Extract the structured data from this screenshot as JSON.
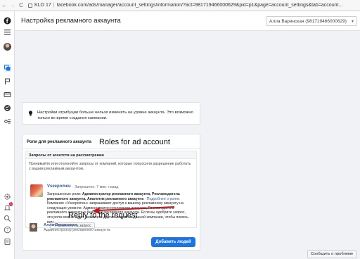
{
  "browser": {
    "back": "←",
    "forward": "→",
    "reload": "C",
    "tab_label": "KLO 17",
    "separator": "|",
    "url": "facebook.com/ads/manager/account_settings/information/?act=981719466000629&pid=p1&page=account_settings&tab=account..."
  },
  "header": {
    "title": "Настройка рекламного аккаунта",
    "account_select": "Алла Варинская (981719466000629)"
  },
  "notice": {
    "text": "Настройки атрибуции больше нельзя изменять на уровне аккаунта. Это возможно только во время создания кампании."
  },
  "roles": {
    "title": "Роли для рекламного аккаунта",
    "requests_header": "Запросы от агентств на рассмотрении",
    "requests_description": "Принимайте или отклоняйте запросы от компаний, которые попросили разрешение работать с вашим рекламным аккаунтом.",
    "request": {
      "company": "Vseepomeu",
      "meta": "· Запрошено: 7 мин. назад",
      "roles_prefix": "Запрошенные роли: ",
      "roles_bold": "Администратор рекламного аккаунта, Рекламодатель рекламного аккаунта, Аналитик рекламного аккаунта",
      "roles_link": " · Подробнее о ролях",
      "body": "Компания «Vseepomeu» запрашивает доступ к вашему рекламному аккаунту на следующих уровнях: Администратор рекламного аккаунта, Рекламодатель рекламного аккаунта и Аналитик рекламного аккаунта. Если вы одобрите запрос, эти роли можно будет назначить другим людям из данной компании, чтобы помочь вам",
      "reply_button": "Ответить на запрос"
    },
    "user": {
      "name": "Алла Варинская",
      "role": "Администратор рекламного аккаунта"
    },
    "add_people_button": "Добавить людей"
  },
  "annotations": {
    "roles": "Roles for ad account",
    "reply": "Reply to the request",
    "arrow_color": "#c0171e"
  },
  "left_rail": {
    "notification_count": "1",
    "icons": [
      "menu-icon",
      "avatar",
      "ads-manager-icon",
      "flag-icon",
      "billing-card-icon",
      "globe-icon",
      "events-icon",
      "settings-icon",
      "notifications-icon",
      "search-icon",
      "help-icon",
      "report-icon"
    ]
  },
  "footer": {
    "report_problem": "Сообщить о проблеме"
  },
  "colors": {
    "accent": "#1b74e4",
    "link": "#385898",
    "page_bg": "#f0f2f5"
  }
}
